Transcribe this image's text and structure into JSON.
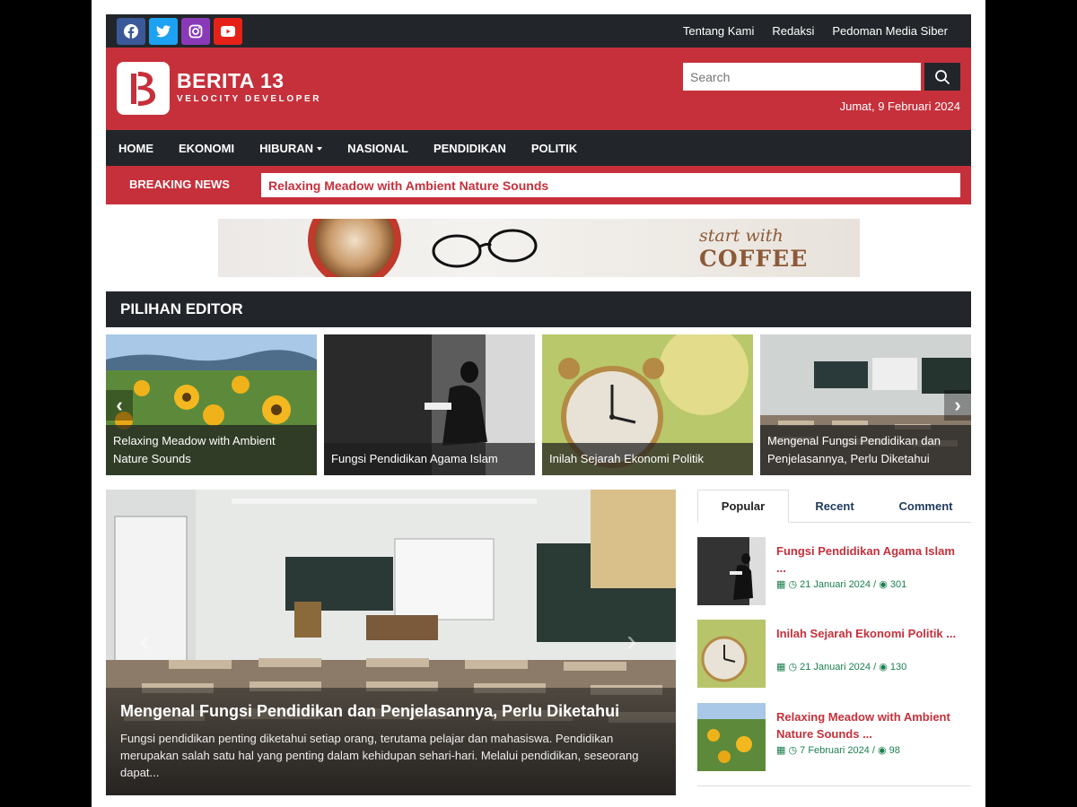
{
  "social": [
    {
      "icon": "facebook-icon",
      "glyph": "f",
      "color": "#3b5998"
    },
    {
      "icon": "twitter-icon",
      "glyph": "t",
      "color": "#1da1f2"
    },
    {
      "icon": "instagram-icon",
      "glyph": "◎",
      "color": "#8a3ab9"
    },
    {
      "icon": "youtube-icon",
      "glyph": "▶",
      "color": "#e62117"
    }
  ],
  "topnav": [
    "Tentang Kami",
    "Redaksi",
    "Pedoman Media Siber"
  ],
  "brand": {
    "title": "BERITA 13",
    "subtitle": "VELOCITY DEVELOPER",
    "color": "#c6303b"
  },
  "search": {
    "placeholder": "Search"
  },
  "date": "Jumat, 9 Februari 2024",
  "nav": [
    "HOME",
    "EKONOMI",
    "HIBURAN",
    "NASIONAL",
    "PENDIDIKAN",
    "POLITIK"
  ],
  "breaking": {
    "label": "BREAKING NEWS",
    "headline": "Relaxing Meadow with Ambient Nature Sounds"
  },
  "banner": {
    "line1": "start with",
    "line2": "COFFEE"
  },
  "editor": {
    "title": "PILIHAN EDITOR",
    "cards": [
      "Relaxing Meadow with Ambient Nature Sounds",
      "Fungsi Pendidikan Agama Islam",
      "Inilah Sejarah Ekonomi Politik",
      "Mengenal Fungsi Pendidikan dan Penjelasannya, Perlu Diketahui"
    ]
  },
  "feature": {
    "title": "Mengenal Fungsi Pendidikan dan Penjelasannya, Perlu Diketahui",
    "excerpt": "Fungsi pendidikan penting diketahui setiap orang, terutama pelajar dan mahasiswa. Pendidikan merupakan salah satu hal yang penting dalam kehidupan sehari-hari. Melalui pendidikan, seseorang dapat..."
  },
  "tabs": [
    "Popular",
    "Recent",
    "Comment"
  ],
  "posts": [
    {
      "title": "Fungsi Pendidikan Agama Islam ...",
      "date": "21 Januari 2024",
      "views": "301"
    },
    {
      "title": "Inilah Sejarah Ekonomi Politik ...",
      "date": "21 Januari 2024",
      "views": "130"
    },
    {
      "title": "Relaxing Meadow with Ambient Nature Sounds ...",
      "date": "7 Februari 2024",
      "views": "98"
    }
  ]
}
